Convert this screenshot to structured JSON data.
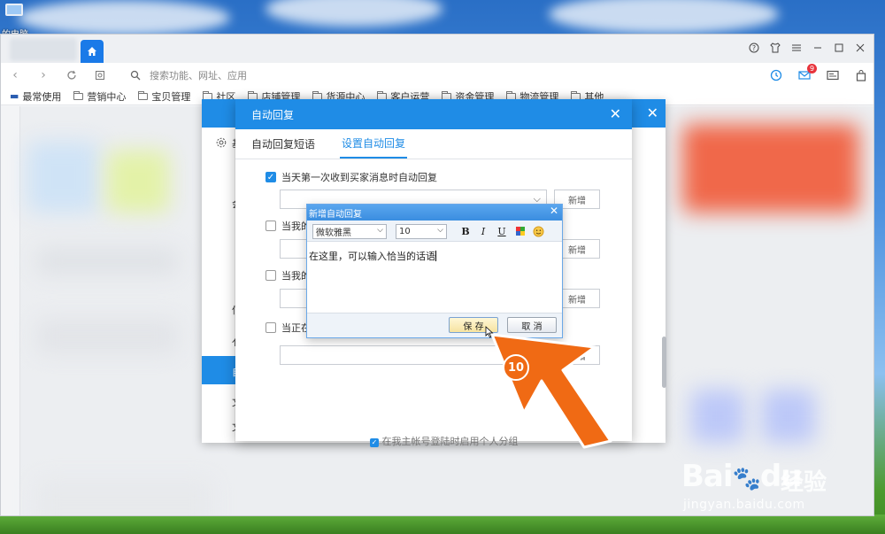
{
  "desktop": {
    "icon_label": "的电脑"
  },
  "address_bar": {
    "placeholder": "搜索功能、网址、应用"
  },
  "nav": {
    "mail_badge": "9"
  },
  "bookmarks": [
    "最常使用",
    "营销中心",
    "宝贝管理",
    "社区",
    "店铺管理",
    "货源中心",
    "客户运营",
    "资金管理",
    "物流管理",
    "其他"
  ],
  "settings_dialog": {
    "side_frags": [
      "基",
      "会",
      "信",
      "亻",
      "自",
      "文",
      "文"
    ]
  },
  "dialog": {
    "title": "自动回复",
    "tabs": [
      "自动回复短语",
      "设置自动回复"
    ],
    "active_tab": 1,
    "rules": [
      {
        "label": "当天第一次收到买家消息时自动回复",
        "checked": true
      },
      {
        "label": "当我的",
        "checked": false
      },
      {
        "label": "当我的",
        "checked": false
      },
      {
        "label": "当正在",
        "checked": false
      }
    ],
    "new_button_label": "新增",
    "bottom_fragment": "在我主帐号登陆时启用个人分组"
  },
  "editor": {
    "title": "新增自动回复",
    "font_family": "微软雅黑",
    "font_size": "10",
    "bold": "B",
    "italic": "I",
    "underline": "U",
    "body_text": "在这里，可以输入恰当的话语",
    "save_label": "保 存",
    "cancel_label": "取 消"
  },
  "annotation": {
    "step_number": "10",
    "color": "#f06a14"
  },
  "watermark": {
    "logo": "Bai",
    "logo_mid": "du",
    "cn": "经验",
    "url": "jingyan.baidu.com"
  }
}
